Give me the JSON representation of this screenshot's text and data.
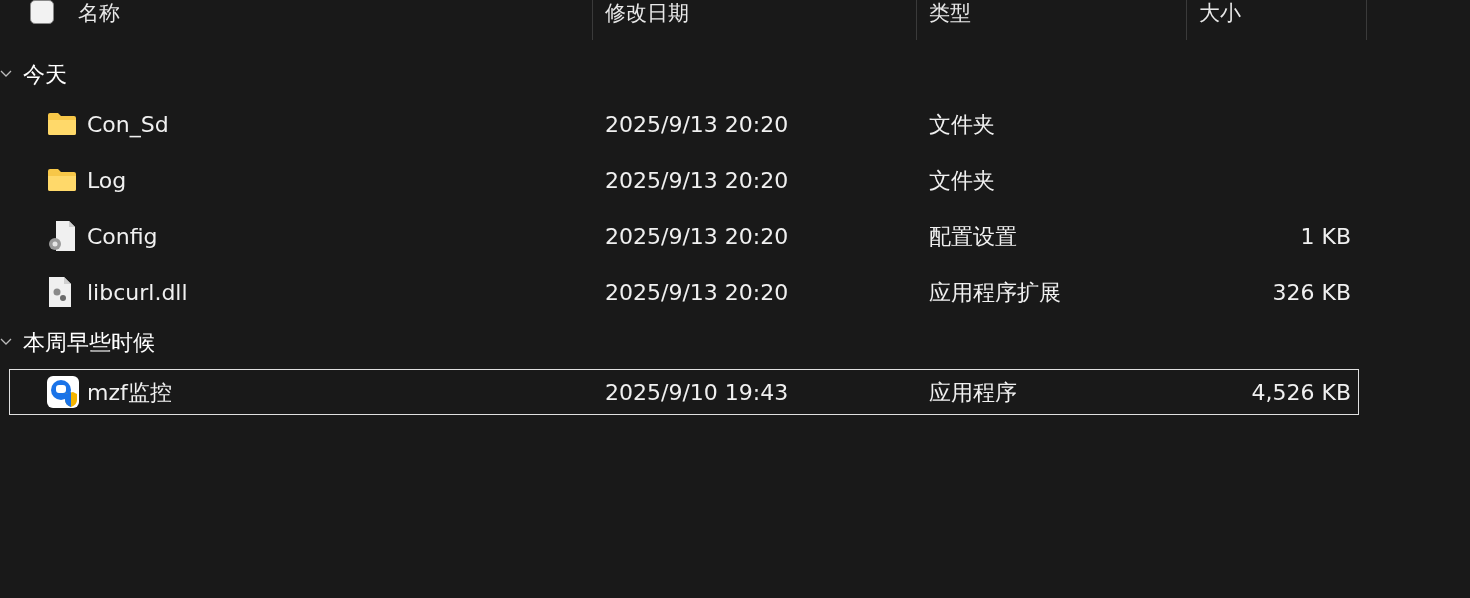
{
  "header": {
    "select_all": {
      "checked": false
    },
    "columns": [
      "名称",
      "修改日期",
      "类型",
      "大小"
    ]
  },
  "groups": [
    {
      "label": "今天",
      "expanded": true,
      "items": [
        {
          "name": "Con_Sd",
          "kind": "folder",
          "date": "2025/9/13 20:20",
          "type": "文件夹",
          "selected": false
        },
        {
          "name": "Log",
          "kind": "folder",
          "date": "2025/9/13 20:20",
          "type": "文件夹",
          "selected": false
        },
        {
          "name": "Config",
          "kind": "config",
          "date": "2025/9/13 20:20",
          "type": "配置设置",
          "size": "1 KB",
          "selected": false
        },
        {
          "name": "libcurl.dll",
          "kind": "dll",
          "date": "2025/9/13 20:20",
          "type": "应用程序扩展",
          "size": "326 KB",
          "selected": false
        }
      ]
    },
    {
      "label": "本周早些时候",
      "expanded": true,
      "items": [
        {
          "name": "mzf监控",
          "kind": "app",
          "date": "2025/9/10 19:43",
          "type": "应用程序",
          "size": "4,526 KB",
          "selected": true
        }
      ]
    }
  ]
}
